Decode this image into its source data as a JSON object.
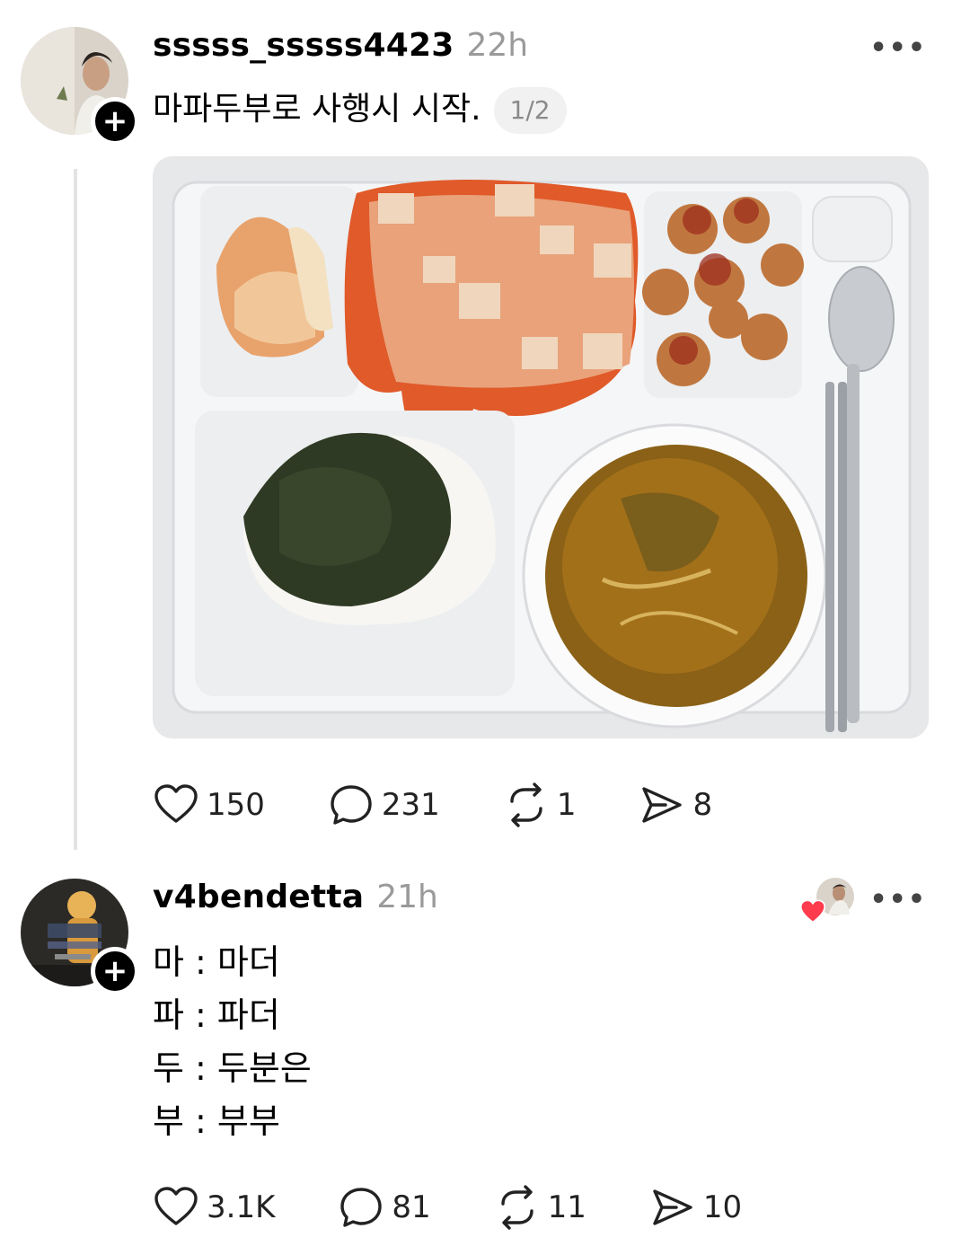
{
  "post1": {
    "username": "sssss_sssss4423",
    "time": "22h",
    "text": "마파두부로 사행시 시작.",
    "page_indicator": "1/2",
    "more_label": "•••",
    "follow_label": "+",
    "stats": {
      "likes": "150",
      "comments": "231",
      "reposts": "1",
      "shares": "8"
    }
  },
  "post2": {
    "username": "v4bendetta",
    "time": "21h",
    "more_label": "•••",
    "follow_label": "+",
    "lines": [
      "마 : 마더",
      "파 : 파더",
      "두 : 두분은",
      "부 : 부부"
    ],
    "stats": {
      "likes": "3.1K",
      "comments": "81",
      "reposts": "11",
      "shares": "10"
    }
  },
  "icons": [
    "heart-icon",
    "comment-icon",
    "repost-icon",
    "share-icon",
    "more-icon",
    "plus-icon"
  ],
  "colors": {
    "liked_heart": "#ff3b4e",
    "timestamp": "#9a9a9a",
    "thread_line": "#e3e3e3"
  }
}
